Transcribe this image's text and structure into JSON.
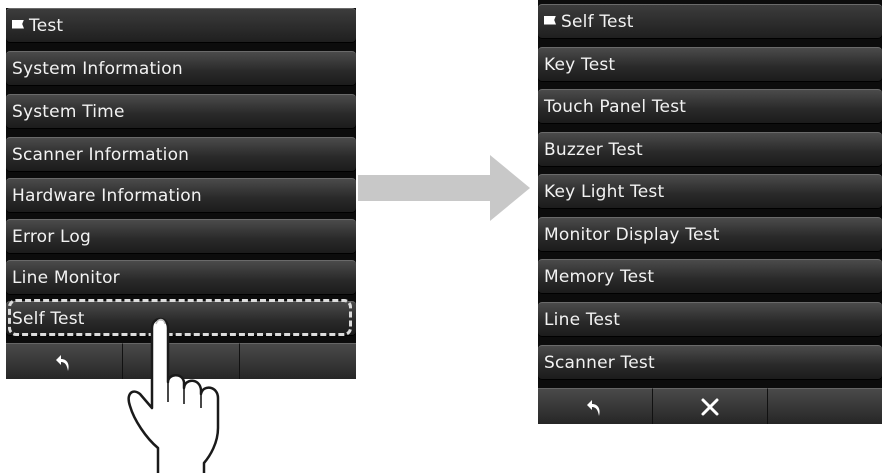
{
  "left_screen": {
    "title": "Test",
    "items": [
      "System Information",
      "System Time",
      "Scanner Information",
      "Hardware Information",
      "Error Log",
      "Line Monitor",
      "Self Test"
    ],
    "bottom_bar": [
      "back-icon",
      "",
      ""
    ]
  },
  "right_screen": {
    "title": "Self Test",
    "items": [
      "Key Test",
      "Touch Panel Test",
      "Buzzer Test",
      "Key Light Test",
      "Monitor Display Test",
      "Memory Test",
      "Line Test",
      "Scanner Test"
    ],
    "bottom_bar": [
      "back-icon",
      "close-icon",
      ""
    ]
  },
  "colors": {
    "arrow": "#c8c8c8",
    "highlight": "#dcdcdc"
  }
}
